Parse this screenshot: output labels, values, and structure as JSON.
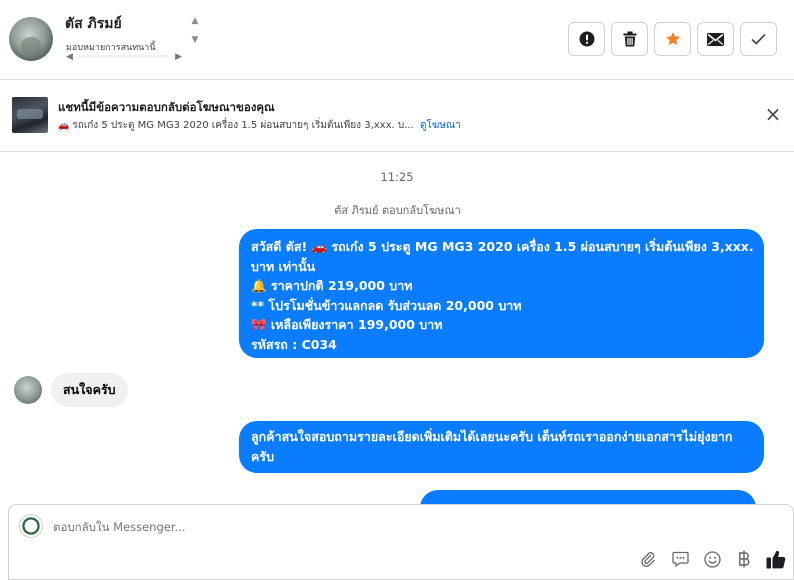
{
  "header": {
    "contact_name": "ตัส ภิรมย์",
    "contact_subtitle": "มอบหมายการสนทนานี้"
  },
  "actions": [
    {
      "name": "report-button",
      "icon": "alert-icon"
    },
    {
      "name": "delete-button",
      "icon": "trash-icon"
    },
    {
      "name": "star-button",
      "icon": "star-icon"
    },
    {
      "name": "mark-unread-button",
      "icon": "envelope-icon"
    },
    {
      "name": "mark-done-button",
      "icon": "check-icon"
    }
  ],
  "banner": {
    "title": "แชทนี้มีข้อความตอบกลับต่อโฆษณาของคุณ",
    "description": "รถเก๋ง 5 ประตู MG MG3 2020 เครื่อง 1.5 ผ่อนสบายๆ เริ่มต้นเพียง 3,xxx. บ...",
    "link": "ดูโฆษณา",
    "close_label": "×"
  },
  "chat": {
    "time": "11:25",
    "reply_note": "ตัส ภิรมย์ ตอบกลับโฆษณา",
    "message1": {
      "line1": "สวัสดี ตัส! 🚗 รถเก๋ง 5 ประตู MG MG3 2020 เครื่อง 1.5 ผ่อนสบายๆ เริ่มต้นเพียง 3,xxx.",
      "line2": "บาท เท่านั้น",
      "line3": "🔔 ราคาปกติ 219,000 บาท",
      "line4": "** โปรโมชั่นข้าวแลกลด รับส่วนลด 20,000 บาท",
      "line5": "🎀  เหลือเพียงราคา 199,000 บาท",
      "line6": " รหัสรถ : C034"
    },
    "incoming": "สนใจครับ",
    "message2": "ลูกค้าสนใจสอบถามรายละเอียดเพิ่มเติมได้เลยนะครับ เต็นท์รถเราออกง่ายเอกสารไม่ยุ่งยากครับ"
  },
  "composer": {
    "placeholder": "ตอบกลับใน Messenger..."
  },
  "tools": [
    {
      "name": "attach-icon"
    },
    {
      "name": "saved-replies-icon"
    },
    {
      "name": "emoji-icon"
    },
    {
      "name": "payment-icon"
    },
    {
      "name": "like-icon"
    }
  ],
  "colors": {
    "accent": "#0a7cff",
    "star": "#f5821f",
    "link": "#0064d1"
  }
}
